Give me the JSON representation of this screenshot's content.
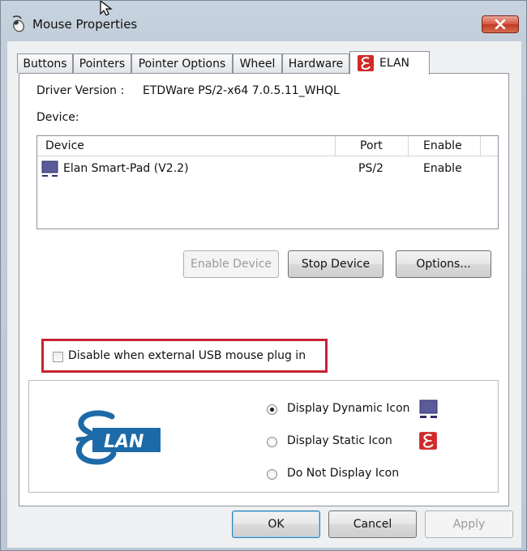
{
  "window": {
    "title": "Mouse Properties"
  },
  "tabs": [
    {
      "label": "Buttons",
      "active": false
    },
    {
      "label": "Pointers",
      "active": false
    },
    {
      "label": "Pointer Options",
      "active": false
    },
    {
      "label": "Wheel",
      "active": false
    },
    {
      "label": "Hardware",
      "active": false
    },
    {
      "label": "ELAN",
      "active": true
    }
  ],
  "elan_tab": {
    "driver_version_label": "Driver Version :",
    "driver_version_value": "ETDWare PS/2-x64 7.0.5.11_WHQL",
    "device_label": "Device:",
    "columns": [
      "Device",
      "Port",
      "Enable"
    ],
    "rows": [
      {
        "device": "Elan Smart-Pad  (V2.2)",
        "port": "PS/2",
        "enable": "Enable"
      }
    ],
    "buttons": {
      "enable_device": "Enable Device",
      "stop_device": "Stop Device",
      "options": "Options..."
    },
    "disable_checkbox": {
      "label": "Disable when external USB mouse plug in",
      "checked": false
    },
    "logo_text": "LAN",
    "icon_options": [
      {
        "label": "Display Dynamic Icon",
        "selected": true
      },
      {
        "label": "Display Static Icon",
        "selected": false
      },
      {
        "label": "Do Not Display Icon",
        "selected": false
      }
    ]
  },
  "dialog_buttons": {
    "ok": "OK",
    "cancel": "Cancel",
    "apply": "Apply"
  },
  "colors": {
    "highlight": "#c62334",
    "elan_logo": "#1d6aa8",
    "elan_icon_red": "#d12a2a",
    "touchpad_icon": "#5b5b9b"
  },
  "icons": [
    "mouse-icon",
    "close-icon",
    "elan-icon",
    "touchpad-icon",
    "elan-logo",
    "cursor-arrow-icon"
  ]
}
